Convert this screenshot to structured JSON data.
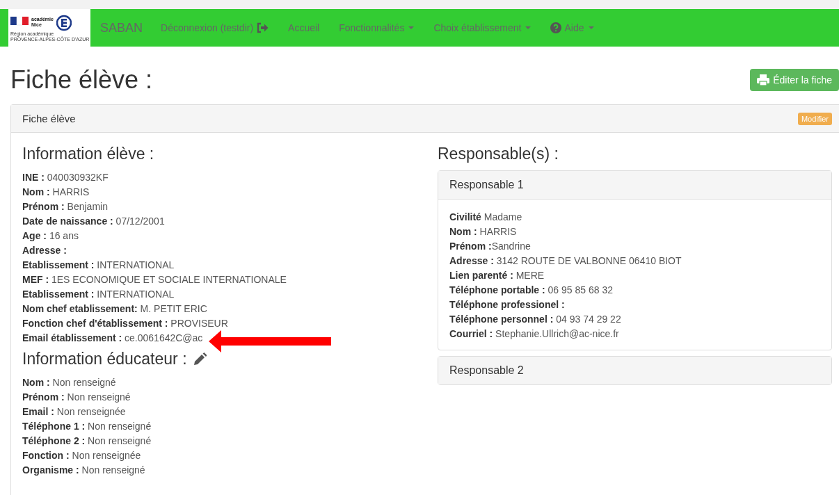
{
  "navbar": {
    "logo": {
      "brand_top": "académie",
      "brand_bottom": "Nice",
      "region": "Région académique",
      "region_name": "PROVENCE-ALPES-CÔTE D'AZUR"
    },
    "brand": "SABAN",
    "items": [
      {
        "label": "Déconnexion (testdir)",
        "kind": "logout"
      },
      {
        "label": "Accueil",
        "kind": "link"
      },
      {
        "label": "Fonctionnalités",
        "kind": "dropdown"
      },
      {
        "label": "Choix établissement",
        "kind": "dropdown"
      },
      {
        "label": "Aide",
        "kind": "help"
      }
    ]
  },
  "page_title": "Fiche élève :",
  "print_button": "Éditer la fiche",
  "panel": {
    "title": "Fiche élève",
    "edit_button": "Modifier",
    "student": {
      "heading": "Information élève :",
      "lines": [
        "**INE :** 040030932KF",
        "**Nom :** HARRIS",
        "**Prénom :** Benjamin",
        "**Date de naissance :** 07/12/2001",
        "**Age :** 16 ans",
        "**Adresse :**",
        "**Etablissement :** INTERNATIONAL",
        "**MEF :** 1ES ECONOMIQUE ET SOCIALE INTERNATIONALE",
        "**Etablissement :** INTERNATIONAL",
        "**Nom chef etablissement:** M. PETIT ERIC",
        "**Fonction chef d'établissement :** PROVISEUR",
        "**Email établissement :** ce.0061642C@ac"
      ]
    },
    "educator": {
      "heading": "Information éducateur :",
      "lines": [
        "**Nom :** Non renseigné",
        "**Prénom :** Non renseigné",
        "**Email :** Non renseignée",
        "**Téléphone 1 :** Non renseigné",
        "**Téléphone 2 :** Non renseigné",
        "**Fonction :** Non renseignée",
        "**Organisme :** Non renseigné"
      ]
    },
    "guardians": {
      "heading": "Responsable(s) :",
      "items": [
        {
          "title": "Responsable 1",
          "expanded": true,
          "lines": [
            "**Civilité** Madame",
            "**Nom :** HARRIS",
            "**Prénom :**Sandrine",
            "**Adresse :** 3142 ROUTE DE VALBONNE 06410 BIOT",
            "**Lien parenté :** MERE",
            "**Téléphone portable :** 06 95 85 68 32",
            "**Téléphone professionel :**",
            "**Téléphone personnel :** 04 93 74 29 22",
            "**Courriel :** Stephanie.Ullrich@ac-nice.fr"
          ]
        },
        {
          "title": "Responsable 2",
          "expanded": false
        }
      ]
    }
  }
}
